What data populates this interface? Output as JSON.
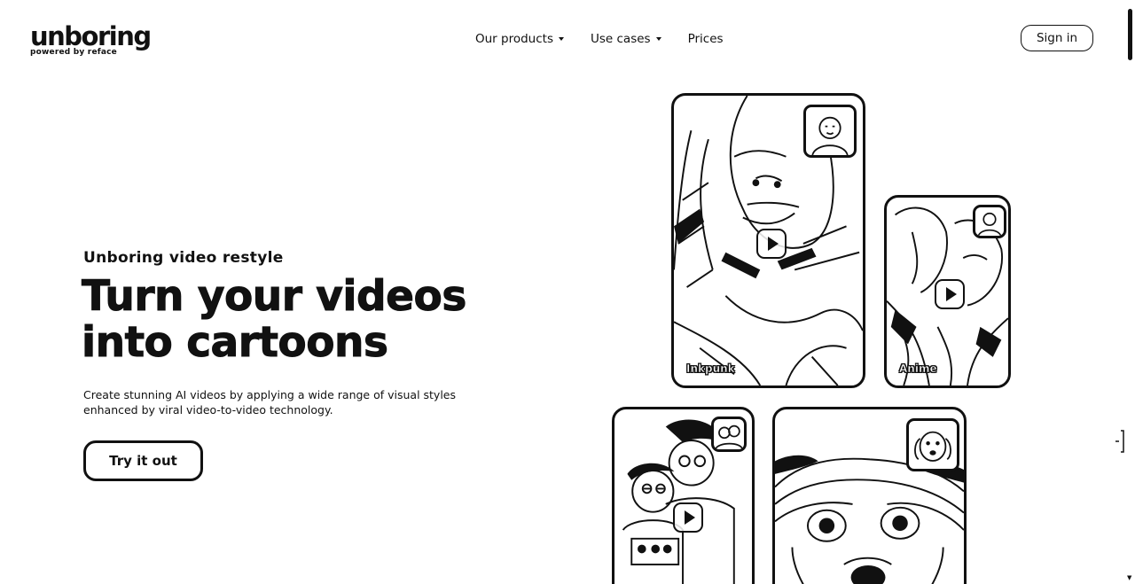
{
  "header": {
    "logo": {
      "name": "unboring",
      "tagline": "powered by reface"
    },
    "nav": [
      {
        "label": "Our products",
        "has_dropdown": true
      },
      {
        "label": "Use cases",
        "has_dropdown": true
      },
      {
        "label": "Prices",
        "has_dropdown": false
      }
    ],
    "sign_in_label": "Sign in"
  },
  "hero": {
    "eyebrow": "Unboring video restyle",
    "headline_line1": "Turn your videos",
    "headline_line2": "into cartoons",
    "description_line1": "Create stunning AI videos by applying a wide range of visual styles",
    "description_line2": "enhanced by viral video-to-video technology.",
    "cta_label": "Try it out"
  },
  "cards": [
    {
      "style_label": "Inkpunk",
      "icon": "play-icon"
    },
    {
      "style_label": "Anime",
      "icon": "play-icon"
    },
    {
      "style_label": "",
      "icon": "play-icon"
    },
    {
      "style_label": "",
      "icon": "play-icon"
    }
  ],
  "colors": {
    "ink": "#111111",
    "background": "#ffffff"
  }
}
